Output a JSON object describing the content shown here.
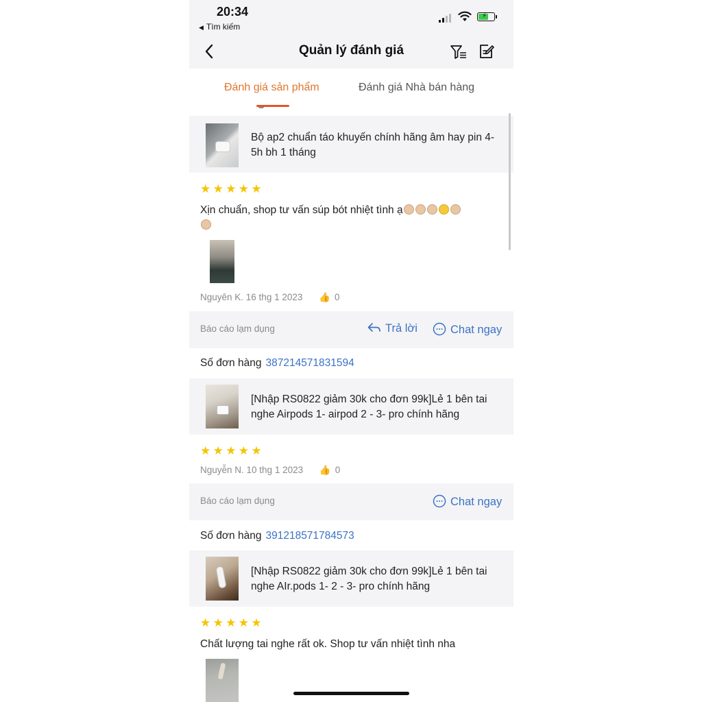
{
  "status": {
    "time": "20:34",
    "back_app": "Tìm kiếm"
  },
  "nav": {
    "title": "Quản lý đánh giá",
    "back_icon": "chevron-left-icon",
    "filter_icon": "filter-icon",
    "edit_icon": "edit-icon"
  },
  "tabs": [
    {
      "label": "Đánh giá sản phẩm",
      "active": true
    },
    {
      "label": "Đánh giá Nhà bán hàng",
      "active": false
    }
  ],
  "colors": {
    "accent": "#e0762d",
    "link": "#3b72c6",
    "star": "#f5c400",
    "muted": "#8a8a8e",
    "panel": "#f4f4f6"
  },
  "reviews": [
    {
      "product_name": "Bộ ap2 chuẩn táo khuyến chính hãng âm hay pin 4-5h bh 1 tháng",
      "rating": 5,
      "text": "Xịn chuẩn, shop tư vấn súp bót nhiệt tình ạ",
      "author_date": "Nguyên K. 16 thg 1 2023",
      "likes": "0",
      "report_label": "Báo cáo lạm dụng",
      "reply_label": "Trả lời",
      "chat_label": "Chat ngay"
    },
    {
      "order_label": "Số đơn hàng",
      "order_number": "387214571831594",
      "product_name": "[Nhập RS0822 giảm 30k cho đơn 99k]Lẻ 1 bên tai nghe Airpods 1- airpod 2 - 3- pro chính hãng",
      "rating": 5,
      "author_date": "Nguyễn N. 10 thg 1 2023",
      "likes": "0",
      "report_label": "Báo cáo lạm dụng",
      "chat_label": "Chat ngay"
    },
    {
      "order_label": "Số đơn hàng",
      "order_number": "391218571784573",
      "product_name": "[Nhập RS0822 giảm 30k cho đơn 99k]Lẻ 1 bên tai nghe AIr.pods 1- 2 - 3- pro chính hãng",
      "rating": 5,
      "text": "Chất lượng tai nghe rất ok. Shop tư vấn nhiệt tình nha"
    }
  ]
}
